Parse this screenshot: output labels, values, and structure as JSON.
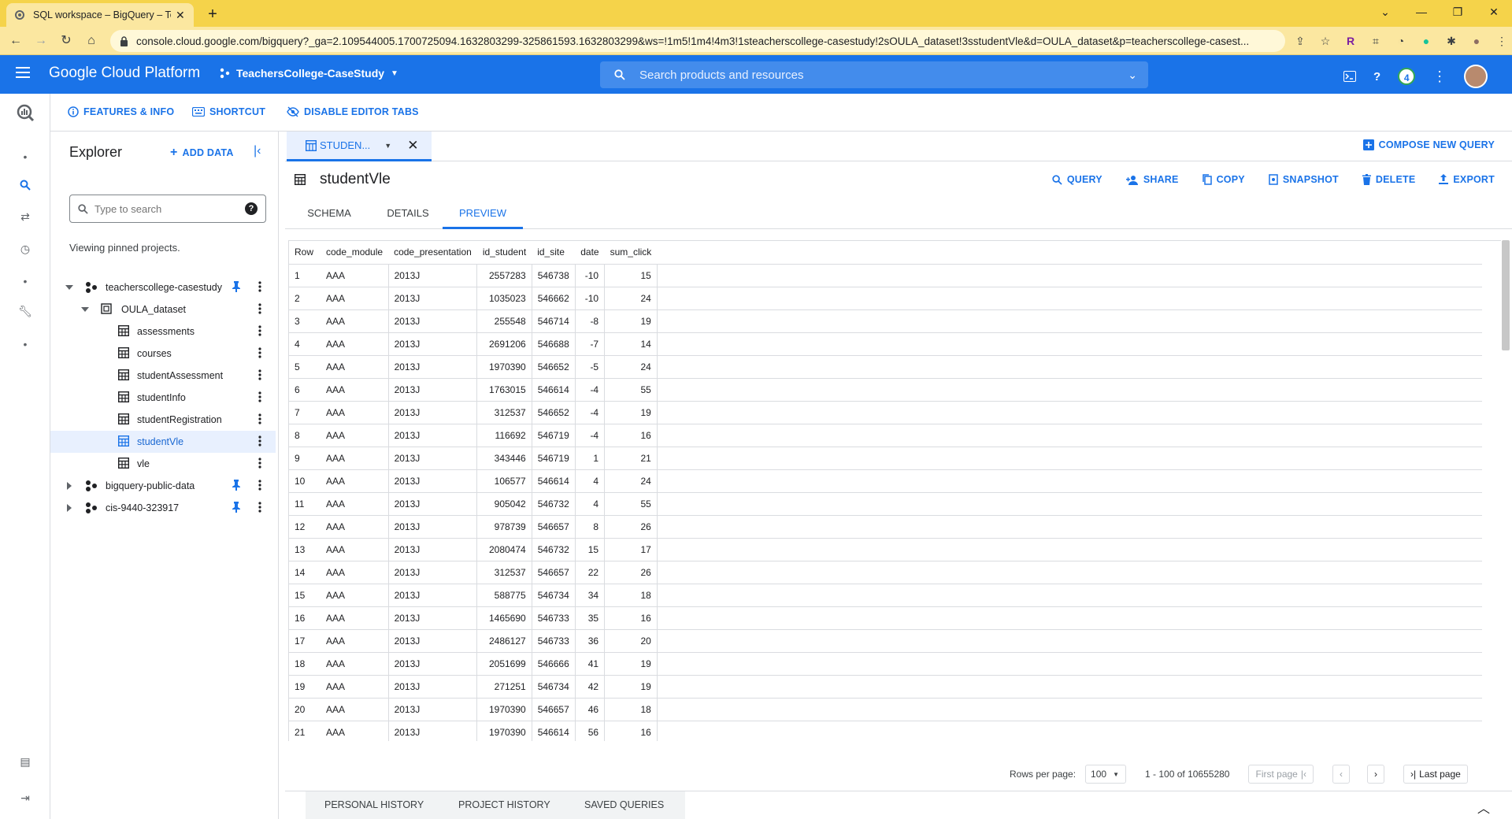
{
  "browser": {
    "tab_title": "SQL workspace – BigQuery – Tea",
    "url": "console.cloud.google.com/bigquery?_ga=2.109544005.1700725094.1632803299-325861593.1632803299&ws=!1m5!1m4!4m3!1steacherscollege-casestudy!2sOULA_dataset!3sstudentVle&d=OULA_dataset&p=teacherscollege-casest..."
  },
  "header": {
    "brand": "Google Cloud Platform",
    "project": "TeachersCollege-CaseStudy",
    "search_placeholder": "Search products and resources",
    "notification_count": "4"
  },
  "toolbar": {
    "features": "FEATURES & INFO",
    "shortcut": "SHORTCUT",
    "disable_tabs": "DISABLE EDITOR TABS"
  },
  "explorer": {
    "title": "Explorer",
    "add_data": "ADD DATA",
    "search_placeholder": "Type to search",
    "viewing": "Viewing pinned projects.",
    "project1": "teacherscollege-casestudy",
    "dataset": "OULA_dataset",
    "tables": [
      "assessments",
      "courses",
      "studentAssessment",
      "studentInfo",
      "studentRegistration",
      "studentVle",
      "vle"
    ],
    "project2": "bigquery-public-data",
    "project3": "cis-9440-323917"
  },
  "editor": {
    "tab_label": "STUDEN...",
    "compose": "COMPOSE NEW QUERY",
    "table_name": "studentVle",
    "actions": {
      "query": "QUERY",
      "share": "SHARE",
      "copy": "COPY",
      "snapshot": "SNAPSHOT",
      "delete": "DELETE",
      "export": "EXPORT"
    },
    "subtabs": {
      "schema": "SCHEMA",
      "details": "DETAILS",
      "preview": "PREVIEW"
    }
  },
  "grid": {
    "columns": [
      "Row",
      "code_module",
      "code_presentation",
      "id_student",
      "id_site",
      "date",
      "sum_click"
    ],
    "rows": [
      [
        "1",
        "AAA",
        "2013J",
        "2557283",
        "546738",
        "-10",
        "15"
      ],
      [
        "2",
        "AAA",
        "2013J",
        "1035023",
        "546662",
        "-10",
        "24"
      ],
      [
        "3",
        "AAA",
        "2013J",
        "255548",
        "546714",
        "-8",
        "19"
      ],
      [
        "4",
        "AAA",
        "2013J",
        "2691206",
        "546688",
        "-7",
        "14"
      ],
      [
        "5",
        "AAA",
        "2013J",
        "1970390",
        "546652",
        "-5",
        "24"
      ],
      [
        "6",
        "AAA",
        "2013J",
        "1763015",
        "546614",
        "-4",
        "55"
      ],
      [
        "7",
        "AAA",
        "2013J",
        "312537",
        "546652",
        "-4",
        "19"
      ],
      [
        "8",
        "AAA",
        "2013J",
        "116692",
        "546719",
        "-4",
        "16"
      ],
      [
        "9",
        "AAA",
        "2013J",
        "343446",
        "546719",
        "1",
        "21"
      ],
      [
        "10",
        "AAA",
        "2013J",
        "106577",
        "546614",
        "4",
        "24"
      ],
      [
        "11",
        "AAA",
        "2013J",
        "905042",
        "546732",
        "4",
        "55"
      ],
      [
        "12",
        "AAA",
        "2013J",
        "978739",
        "546657",
        "8",
        "26"
      ],
      [
        "13",
        "AAA",
        "2013J",
        "2080474",
        "546732",
        "15",
        "17"
      ],
      [
        "14",
        "AAA",
        "2013J",
        "312537",
        "546657",
        "22",
        "26"
      ],
      [
        "15",
        "AAA",
        "2013J",
        "588775",
        "546734",
        "34",
        "18"
      ],
      [
        "16",
        "AAA",
        "2013J",
        "1465690",
        "546733",
        "35",
        "16"
      ],
      [
        "17",
        "AAA",
        "2013J",
        "2486127",
        "546733",
        "36",
        "20"
      ],
      [
        "18",
        "AAA",
        "2013J",
        "2051699",
        "546666",
        "41",
        "19"
      ],
      [
        "19",
        "AAA",
        "2013J",
        "271251",
        "546734",
        "42",
        "19"
      ],
      [
        "20",
        "AAA",
        "2013J",
        "1970390",
        "546657",
        "46",
        "18"
      ],
      [
        "21",
        "AAA",
        "2013J",
        "1970390",
        "546614",
        "56",
        "16"
      ]
    ]
  },
  "pager": {
    "rows_per_page_label": "Rows per page:",
    "rows_per_page": "100",
    "range": "1 - 100 of 10655280",
    "first": "First page",
    "last": "Last page"
  },
  "history": {
    "personal": "PERSONAL HISTORY",
    "project": "PROJECT HISTORY",
    "saved": "SAVED QUERIES"
  },
  "colors": {
    "accent": "#1a73e8",
    "browser_frame": "#f5d34a"
  }
}
